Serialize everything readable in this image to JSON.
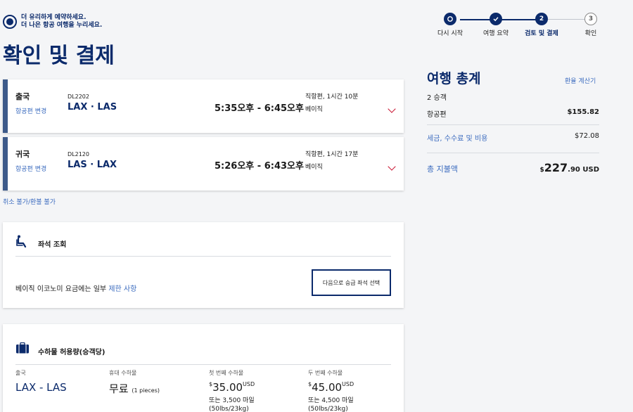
{
  "brand": {
    "line1": "더 유리하게 예약하세요.",
    "line2": "더 나은 항공 여행을 누리세요."
  },
  "stepper": {
    "steps": [
      {
        "num": "",
        "label": "다시 시작"
      },
      {
        "num": "",
        "label": "여행 요약"
      },
      {
        "num": "2",
        "label": "검토 및 결제"
      },
      {
        "num": "3",
        "label": "확인"
      }
    ]
  },
  "page": {
    "title": "확인 및 결제"
  },
  "flights": [
    {
      "direction": "출국",
      "change_label": "항공편 변경",
      "flight_number": "DL2202",
      "route": "LAX · LAS",
      "times": "5:35오후 - 6:45오후",
      "duration": "직항편, 1시간 10분",
      "fare_class": "베이직"
    },
    {
      "direction": "귀국",
      "change_label": "항공편 변경",
      "flight_number": "DL2120",
      "route": "LAS · LAX",
      "times": "5:26오후 - 6:43오후",
      "duration": "직항편, 1시간 17분",
      "fare_class": "베이직"
    }
  ],
  "refund_note": "취소 불가/환불 불가",
  "seat": {
    "title": "좌석 조회",
    "desc_prefix": "베이직 이코노미 요금에는 일부 ",
    "desc_link": "제한 사항",
    "button": "다음으로 승급 좌석 선택"
  },
  "baggage": {
    "title": "수하물 허용량(승객당)",
    "columns": [
      {
        "head": "출국",
        "main": "LAX - LAS",
        "note": "",
        "sub1": "",
        "sub2": ""
      },
      {
        "head": "휴대 수하물",
        "main": "무료",
        "note": "(1 pieces)",
        "sub1": "",
        "sub2": ""
      },
      {
        "head": "첫 번째 수하물",
        "symbol": "$",
        "main": "35.00",
        "note": "USD",
        "sub1": "또는 3,500 마일",
        "sub2": "(50lbs/23kg)"
      },
      {
        "head": "두 번째 수하물",
        "symbol": "$",
        "main": "45.00",
        "note": "USD",
        "sub1": "또는 4,500 마일",
        "sub2": "(50lbs/23kg)"
      }
    ]
  },
  "summary": {
    "title": "여행 총계",
    "calculator": "환율 계산기",
    "passengers": "2 승객",
    "flight_label": "항공편",
    "flight_value": "$155.82",
    "tax_label": "세금, 수수료 및 비용",
    "tax_value": "$72.08",
    "total_label": "총 지불액",
    "total_symbol": "$",
    "total_major": "227",
    "total_minor": ".90 USD"
  },
  "colors": {
    "navy": "#0b2a6b",
    "link": "#3c6cbf",
    "accent_red": "#c8102e"
  }
}
